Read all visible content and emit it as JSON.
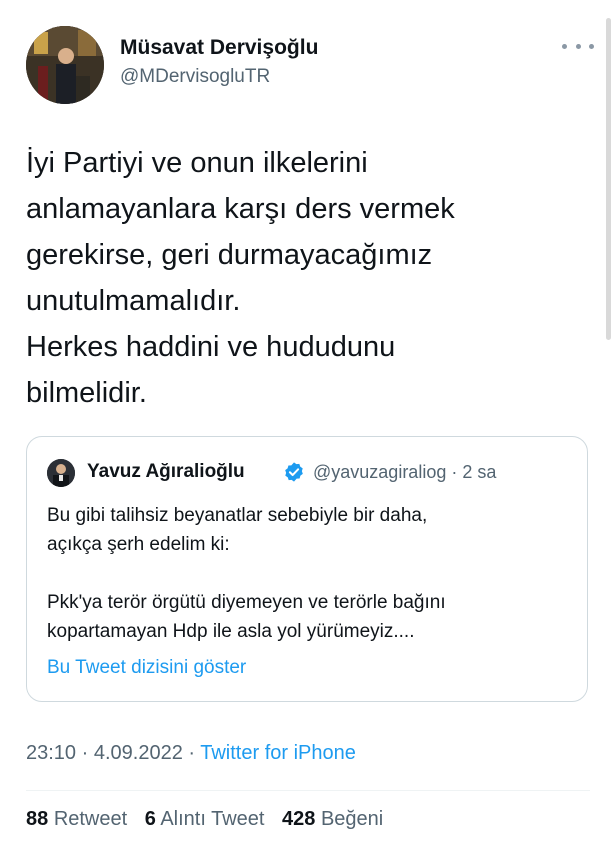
{
  "author": {
    "name": "Müsavat Dervişoğlu",
    "handle": "@MDervisogluTR",
    "avatar": "avatar"
  },
  "tweet": {
    "lines": [
      "İyi Partiyi ve onun ilkelerini",
      "anlamayanlara karşı ders vermek",
      "gerekirse, geri durmayacağımız",
      "unutulmamalıdır.",
      "Herkes haddini ve hududunu",
      "bilmelidir."
    ]
  },
  "quote": {
    "name": "Yavuz Ağıralioğlu",
    "verified_icon": "verified-badge-icon",
    "handle_time": "@yavuzagiraliog · 2 sa",
    "lines_1": [
      "Bu gibi talihsiz beyanatlar sebebiyle bir daha,",
      "açıkça şerh edelim ki:"
    ],
    "lines_2": [
      "Pkk'ya terör örgütü diyemeyen ve terörle bağını",
      "kopartamayan Hdp ile asla yol yürümeyiz...."
    ],
    "show_thread": "Bu Tweet dizisini göster"
  },
  "meta": {
    "time": "23:10",
    "separator": " · ",
    "date": "4.09.2022",
    "source": "Twitter for iPhone"
  },
  "stats": {
    "retweets_count": "88",
    "retweets_label": "Retweet",
    "quotes_count": "6",
    "quotes_label": "Alıntı Tweet",
    "likes_count": "428",
    "likes_label": "Beğeni"
  },
  "colors": {
    "accent": "#1d9bf0",
    "text": "#0f1419",
    "secondary": "#536471",
    "border": "#cfd9de"
  }
}
